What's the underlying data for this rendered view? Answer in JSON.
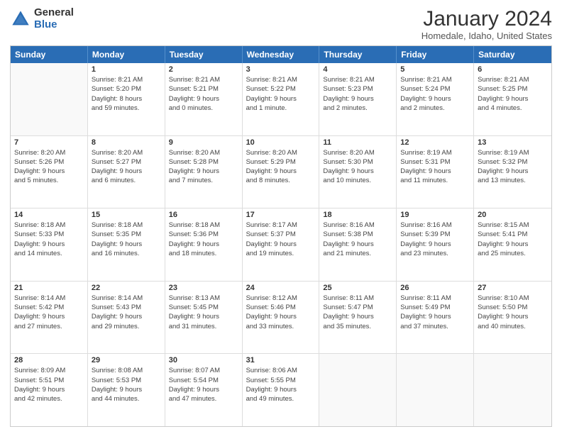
{
  "logo": {
    "general": "General",
    "blue": "Blue"
  },
  "title": "January 2024",
  "location": "Homedale, Idaho, United States",
  "weekdays": [
    "Sunday",
    "Monday",
    "Tuesday",
    "Wednesday",
    "Thursday",
    "Friday",
    "Saturday"
  ],
  "weeks": [
    [
      {
        "day": "",
        "lines": []
      },
      {
        "day": "1",
        "lines": [
          "Sunrise: 8:21 AM",
          "Sunset: 5:20 PM",
          "Daylight: 8 hours",
          "and 59 minutes."
        ]
      },
      {
        "day": "2",
        "lines": [
          "Sunrise: 8:21 AM",
          "Sunset: 5:21 PM",
          "Daylight: 9 hours",
          "and 0 minutes."
        ]
      },
      {
        "day": "3",
        "lines": [
          "Sunrise: 8:21 AM",
          "Sunset: 5:22 PM",
          "Daylight: 9 hours",
          "and 1 minute."
        ]
      },
      {
        "day": "4",
        "lines": [
          "Sunrise: 8:21 AM",
          "Sunset: 5:23 PM",
          "Daylight: 9 hours",
          "and 2 minutes."
        ]
      },
      {
        "day": "5",
        "lines": [
          "Sunrise: 8:21 AM",
          "Sunset: 5:24 PM",
          "Daylight: 9 hours",
          "and 2 minutes."
        ]
      },
      {
        "day": "6",
        "lines": [
          "Sunrise: 8:21 AM",
          "Sunset: 5:25 PM",
          "Daylight: 9 hours",
          "and 4 minutes."
        ]
      }
    ],
    [
      {
        "day": "7",
        "lines": [
          "Sunrise: 8:20 AM",
          "Sunset: 5:26 PM",
          "Daylight: 9 hours",
          "and 5 minutes."
        ]
      },
      {
        "day": "8",
        "lines": [
          "Sunrise: 8:20 AM",
          "Sunset: 5:27 PM",
          "Daylight: 9 hours",
          "and 6 minutes."
        ]
      },
      {
        "day": "9",
        "lines": [
          "Sunrise: 8:20 AM",
          "Sunset: 5:28 PM",
          "Daylight: 9 hours",
          "and 7 minutes."
        ]
      },
      {
        "day": "10",
        "lines": [
          "Sunrise: 8:20 AM",
          "Sunset: 5:29 PM",
          "Daylight: 9 hours",
          "and 8 minutes."
        ]
      },
      {
        "day": "11",
        "lines": [
          "Sunrise: 8:20 AM",
          "Sunset: 5:30 PM",
          "Daylight: 9 hours",
          "and 10 minutes."
        ]
      },
      {
        "day": "12",
        "lines": [
          "Sunrise: 8:19 AM",
          "Sunset: 5:31 PM",
          "Daylight: 9 hours",
          "and 11 minutes."
        ]
      },
      {
        "day": "13",
        "lines": [
          "Sunrise: 8:19 AM",
          "Sunset: 5:32 PM",
          "Daylight: 9 hours",
          "and 13 minutes."
        ]
      }
    ],
    [
      {
        "day": "14",
        "lines": [
          "Sunrise: 8:18 AM",
          "Sunset: 5:33 PM",
          "Daylight: 9 hours",
          "and 14 minutes."
        ]
      },
      {
        "day": "15",
        "lines": [
          "Sunrise: 8:18 AM",
          "Sunset: 5:35 PM",
          "Daylight: 9 hours",
          "and 16 minutes."
        ]
      },
      {
        "day": "16",
        "lines": [
          "Sunrise: 8:18 AM",
          "Sunset: 5:36 PM",
          "Daylight: 9 hours",
          "and 18 minutes."
        ]
      },
      {
        "day": "17",
        "lines": [
          "Sunrise: 8:17 AM",
          "Sunset: 5:37 PM",
          "Daylight: 9 hours",
          "and 19 minutes."
        ]
      },
      {
        "day": "18",
        "lines": [
          "Sunrise: 8:16 AM",
          "Sunset: 5:38 PM",
          "Daylight: 9 hours",
          "and 21 minutes."
        ]
      },
      {
        "day": "19",
        "lines": [
          "Sunrise: 8:16 AM",
          "Sunset: 5:39 PM",
          "Daylight: 9 hours",
          "and 23 minutes."
        ]
      },
      {
        "day": "20",
        "lines": [
          "Sunrise: 8:15 AM",
          "Sunset: 5:41 PM",
          "Daylight: 9 hours",
          "and 25 minutes."
        ]
      }
    ],
    [
      {
        "day": "21",
        "lines": [
          "Sunrise: 8:14 AM",
          "Sunset: 5:42 PM",
          "Daylight: 9 hours",
          "and 27 minutes."
        ]
      },
      {
        "day": "22",
        "lines": [
          "Sunrise: 8:14 AM",
          "Sunset: 5:43 PM",
          "Daylight: 9 hours",
          "and 29 minutes."
        ]
      },
      {
        "day": "23",
        "lines": [
          "Sunrise: 8:13 AM",
          "Sunset: 5:45 PM",
          "Daylight: 9 hours",
          "and 31 minutes."
        ]
      },
      {
        "day": "24",
        "lines": [
          "Sunrise: 8:12 AM",
          "Sunset: 5:46 PM",
          "Daylight: 9 hours",
          "and 33 minutes."
        ]
      },
      {
        "day": "25",
        "lines": [
          "Sunrise: 8:11 AM",
          "Sunset: 5:47 PM",
          "Daylight: 9 hours",
          "and 35 minutes."
        ]
      },
      {
        "day": "26",
        "lines": [
          "Sunrise: 8:11 AM",
          "Sunset: 5:49 PM",
          "Daylight: 9 hours",
          "and 37 minutes."
        ]
      },
      {
        "day": "27",
        "lines": [
          "Sunrise: 8:10 AM",
          "Sunset: 5:50 PM",
          "Daylight: 9 hours",
          "and 40 minutes."
        ]
      }
    ],
    [
      {
        "day": "28",
        "lines": [
          "Sunrise: 8:09 AM",
          "Sunset: 5:51 PM",
          "Daylight: 9 hours",
          "and 42 minutes."
        ]
      },
      {
        "day": "29",
        "lines": [
          "Sunrise: 8:08 AM",
          "Sunset: 5:53 PM",
          "Daylight: 9 hours",
          "and 44 minutes."
        ]
      },
      {
        "day": "30",
        "lines": [
          "Sunrise: 8:07 AM",
          "Sunset: 5:54 PM",
          "Daylight: 9 hours",
          "and 47 minutes."
        ]
      },
      {
        "day": "31",
        "lines": [
          "Sunrise: 8:06 AM",
          "Sunset: 5:55 PM",
          "Daylight: 9 hours",
          "and 49 minutes."
        ]
      },
      {
        "day": "",
        "lines": []
      },
      {
        "day": "",
        "lines": []
      },
      {
        "day": "",
        "lines": []
      }
    ]
  ]
}
